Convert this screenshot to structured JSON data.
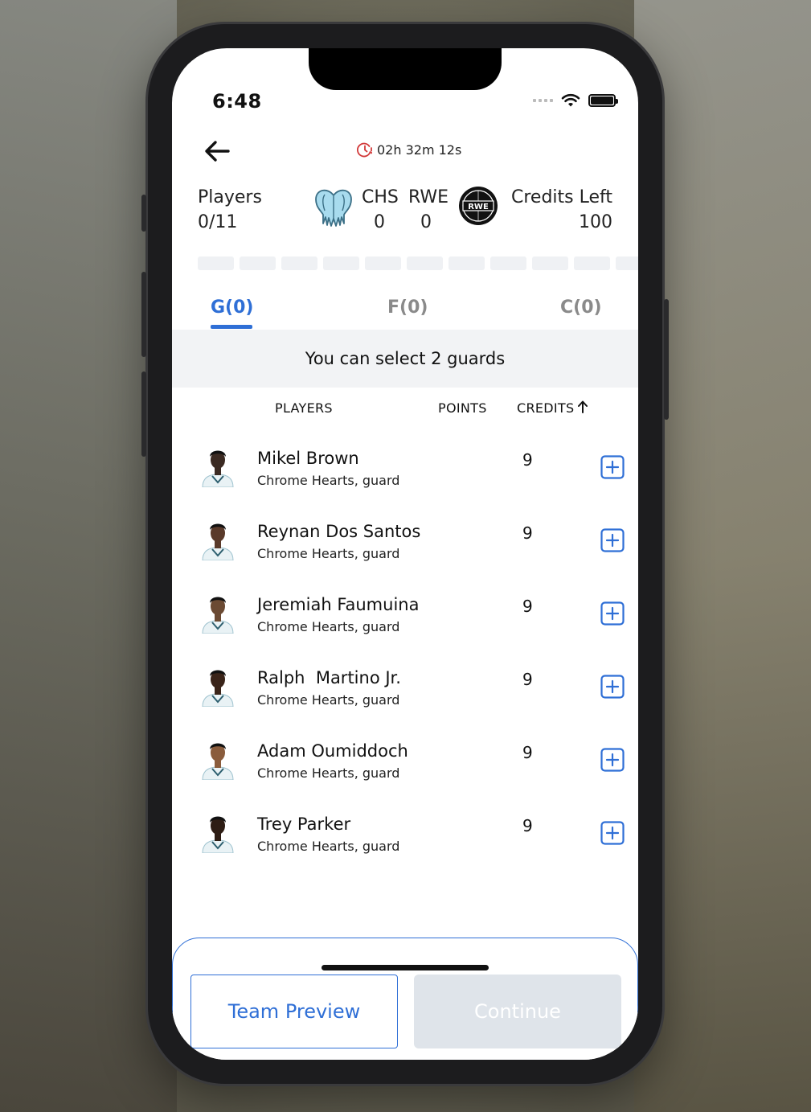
{
  "status_bar": {
    "time": "6:48"
  },
  "header": {
    "timer": "02h 32m 12s"
  },
  "summary": {
    "players_label": "Players",
    "players_value": "0/11",
    "team_left": "CHS",
    "team_left_score": "0",
    "team_right": "RWE",
    "team_right_score": "0",
    "team_right_logo_text": "RWE",
    "credits_label": "Credits Left",
    "credits_value": "100"
  },
  "tabs": [
    {
      "label": "G(0)",
      "active": true
    },
    {
      "label": "F(0)",
      "active": false
    },
    {
      "label": "C(0)",
      "active": false
    }
  ],
  "info_message": "You can select 2 guards",
  "columns": {
    "players": "PLAYERS",
    "points": "POINTS",
    "credits": "CREDITS"
  },
  "players": [
    {
      "name": "Mikel Brown",
      "team": "Chrome Hearts, guard",
      "credits": "9"
    },
    {
      "name": "Reynan Dos Santos",
      "team": "Chrome Hearts, guard",
      "credits": "9"
    },
    {
      "name": "Jeremiah Faumuina",
      "team": "Chrome Hearts, guard",
      "credits": "9"
    },
    {
      "name": "Ralph  Martino Jr.",
      "team": "Chrome Hearts, guard",
      "credits": "9"
    },
    {
      "name": "Adam Oumiddoch",
      "team": "Chrome Hearts, guard",
      "credits": "9"
    },
    {
      "name": "Trey Parker",
      "team": "Chrome Hearts, guard",
      "credits": "9"
    }
  ],
  "actions": {
    "team_preview": "Team Preview",
    "continue": "Continue"
  },
  "colors": {
    "accent": "#2f6fd6",
    "disabled": "#dfe4ea",
    "timer_icon": "#d23a3a"
  },
  "icons": [
    "back-arrow-icon",
    "clock-icon",
    "wifi-icon",
    "battery-icon",
    "sort-arrow-up-icon",
    "plus-square-icon"
  ]
}
